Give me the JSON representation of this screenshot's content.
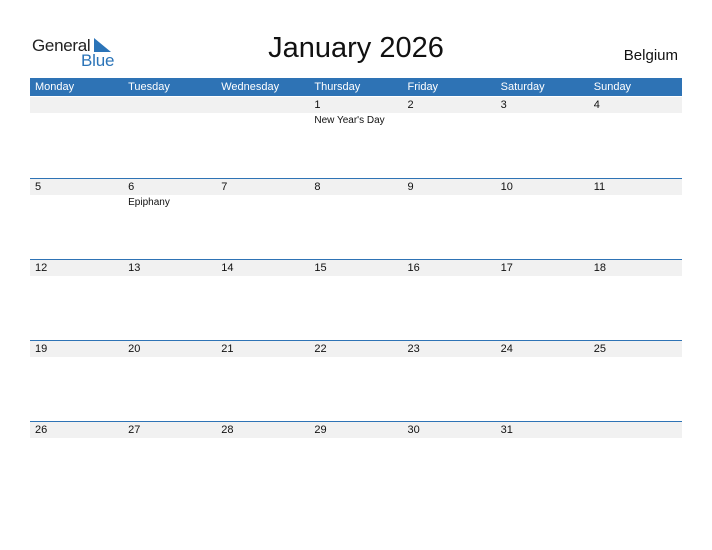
{
  "logo": {
    "word1": "General",
    "word2": "Blue"
  },
  "title": "January 2026",
  "country": "Belgium",
  "colors": {
    "accent": "#2e73b5",
    "band": "#f1f1f1",
    "logo_blue": "#2b74b8"
  },
  "weekdays": [
    "Monday",
    "Tuesday",
    "Wednesday",
    "Thursday",
    "Friday",
    "Saturday",
    "Sunday"
  ],
  "weeks": [
    [
      {
        "day": ""
      },
      {
        "day": ""
      },
      {
        "day": ""
      },
      {
        "day": "1",
        "event": "New Year's Day"
      },
      {
        "day": "2"
      },
      {
        "day": "3"
      },
      {
        "day": "4"
      }
    ],
    [
      {
        "day": "5"
      },
      {
        "day": "6",
        "event": "Epiphany"
      },
      {
        "day": "7"
      },
      {
        "day": "8"
      },
      {
        "day": "9"
      },
      {
        "day": "10"
      },
      {
        "day": "11"
      }
    ],
    [
      {
        "day": "12"
      },
      {
        "day": "13"
      },
      {
        "day": "14"
      },
      {
        "day": "15"
      },
      {
        "day": "16"
      },
      {
        "day": "17"
      },
      {
        "day": "18"
      }
    ],
    [
      {
        "day": "19"
      },
      {
        "day": "20"
      },
      {
        "day": "21"
      },
      {
        "day": "22"
      },
      {
        "day": "23"
      },
      {
        "day": "24"
      },
      {
        "day": "25"
      }
    ],
    [
      {
        "day": "26"
      },
      {
        "day": "27"
      },
      {
        "day": "28"
      },
      {
        "day": "29"
      },
      {
        "day": "30"
      },
      {
        "day": "31"
      },
      {
        "day": ""
      }
    ]
  ]
}
